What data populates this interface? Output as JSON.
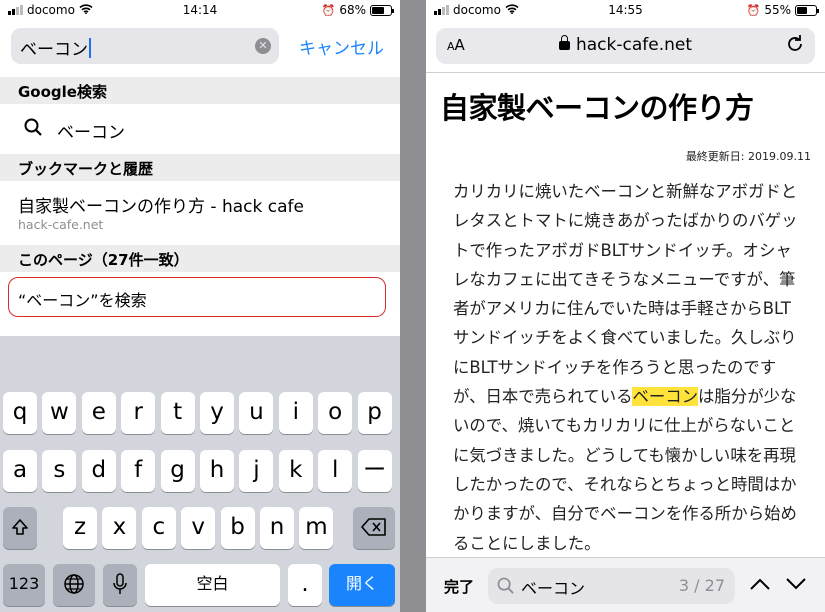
{
  "left": {
    "status": {
      "carrier": "docomo",
      "time": "14:14",
      "battery": "68%",
      "battery_level": 0.68
    },
    "search": {
      "query": "ベーコン",
      "cancel": "キャンセル"
    },
    "google": {
      "header": "Google検索",
      "suggestion": "ベーコン"
    },
    "history": {
      "header": "ブックマークと履歴",
      "title": "自家製ベーコンの作り方 - hack cafe",
      "url": "hack-cafe.net"
    },
    "onpage": {
      "header": "このページ（27件一致）",
      "find_label": "“ベーコン”を検索"
    },
    "keyboard": {
      "row1": [
        "q",
        "w",
        "e",
        "r",
        "t",
        "y",
        "u",
        "i",
        "o",
        "p"
      ],
      "row2": [
        "a",
        "s",
        "d",
        "f",
        "g",
        "h",
        "j",
        "k",
        "l",
        "ー"
      ],
      "row3": [
        "z",
        "x",
        "c",
        "v",
        "b",
        "n",
        "m"
      ],
      "num": "123",
      "space": "空白",
      "period": ".",
      "enter": "開く"
    }
  },
  "right": {
    "status": {
      "carrier": "docomo",
      "time": "14:55",
      "battery": "55%",
      "battery_level": 0.55
    },
    "url": {
      "aa_small": "A",
      "aa_big": "A",
      "host": "hack-cafe.net"
    },
    "article": {
      "title": "自家製ベーコンの作り方",
      "updated": "最終更新日: 2019.09.11",
      "before": "カリカリに焼いたベーコンと新鮮なアボガドとレタスとトマトに焼きあがったばかりのバゲットで作ったアボガドBLTサンドイッチ。オシャレなカフェに出てきそうなメニューですが、筆者がアメリカに住んでいた時は手軽さからBLTサンドイッチをよく食べていました。久しぶりにBLTサンドイッチを作ろうと思ったのですが、日本で売られている",
      "highlight": "ベーコン",
      "after": "は脂分が少ないので、焼いてもカリカリに仕上がらないことに気づきました。どうしても懐かしい味を再現したかったので、それならとちょっと時間はかかりますが、自分でベーコンを作る所から始めることにしました。"
    },
    "find": {
      "done": "完了",
      "query": "ベーコン",
      "count": "3 / 27"
    }
  }
}
